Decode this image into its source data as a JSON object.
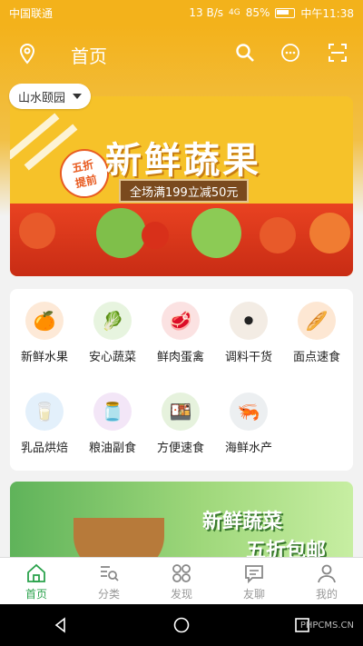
{
  "status": {
    "carrier": "中国联通",
    "speed": "13 B/s",
    "signal": "4G",
    "battery": "85%",
    "time": "中午11:38"
  },
  "header": {
    "title": "首页",
    "location": "山水颐园"
  },
  "banner": {
    "title": "新鲜蔬果",
    "badge_line1": "五折",
    "badge_line2": "提前",
    "tagline": "全场满199立减50元"
  },
  "categories": [
    {
      "label": "新鲜水果",
      "icon": "fruit-icon",
      "color": "#fde9d7"
    },
    {
      "label": "安心蔬菜",
      "icon": "vegetable-icon",
      "color": "#e7f4df"
    },
    {
      "label": "鲜肉蛋禽",
      "icon": "meat-icon",
      "color": "#fbe2e2"
    },
    {
      "label": "调料干货",
      "icon": "spice-icon",
      "color": "#f3ece4"
    },
    {
      "label": "面点速食",
      "icon": "bread-icon",
      "color": "#fde7d3"
    },
    {
      "label": "乳品烘焙",
      "icon": "milk-icon",
      "color": "#e3f0fb"
    },
    {
      "label": "粮油副食",
      "icon": "oil-icon",
      "color": "#f3e6f7"
    },
    {
      "label": "方便速食",
      "icon": "instant-food-icon",
      "color": "#e6f2dd"
    },
    {
      "label": "海鲜水产",
      "icon": "seafood-icon",
      "color": "#eceff1"
    }
  ],
  "promo": {
    "line1": "新鲜蔬菜",
    "line2": "五折包邮"
  },
  "tabs": [
    {
      "label": "首页",
      "active": true
    },
    {
      "label": "分类"
    },
    {
      "label": "发现"
    },
    {
      "label": "友聊"
    },
    {
      "label": "我的"
    }
  ],
  "watermark": "PHPCMS.CN"
}
